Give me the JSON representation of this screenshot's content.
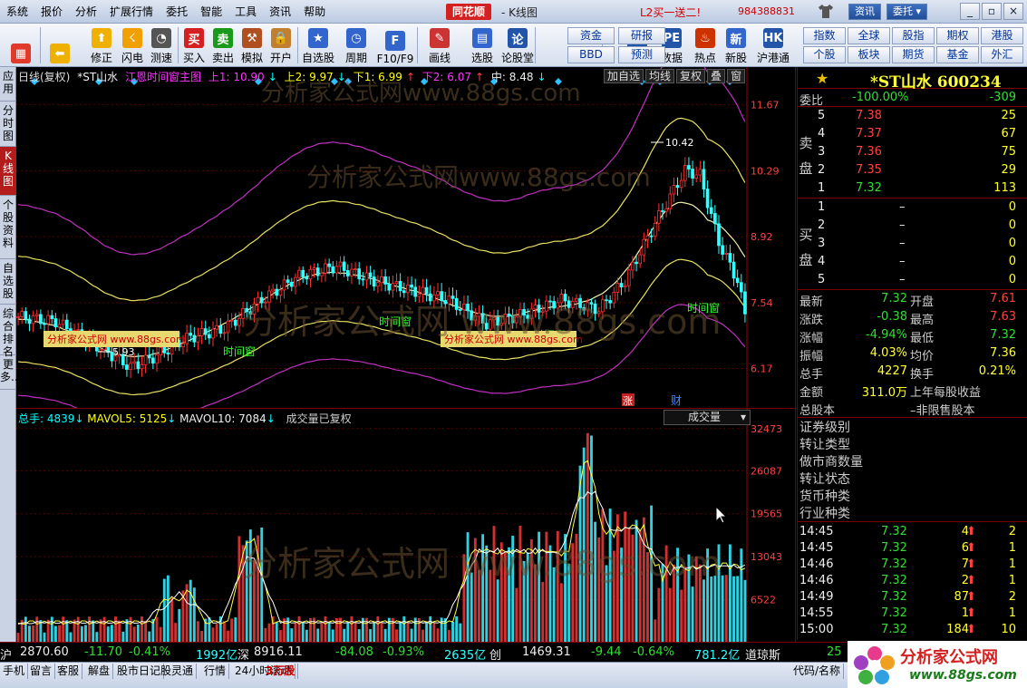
{
  "menubar": {
    "items": [
      "系统",
      "报价",
      "分析",
      "扩展行情",
      "委托",
      "智能",
      "工具",
      "资讯",
      "帮助"
    ],
    "brand": "同花顺",
    "window_title": "- K线图",
    "promo": "L2买一送二!",
    "account": "984388831",
    "btn_news": "资讯",
    "btn_trade": "委托 ▾",
    "min": "_",
    "restore": "▫",
    "close": "×"
  },
  "toolbar": {
    "buttons": [
      {
        "label": "",
        "icon": "app-grid-icon",
        "color": "#e03a2a"
      },
      {
        "label": "",
        "icon": "back-arrow-icon",
        "color": "#f0b000"
      },
      {
        "label": "修正",
        "icon": "up-arrow-icon",
        "color": "#f0b000"
      },
      {
        "label": "闪电",
        "icon": "lightning-icon",
        "color": "#f0a000"
      },
      {
        "label": "测速",
        "icon": "speed-icon",
        "color": "#555"
      },
      {
        "label": "买入",
        "icon": "buy-icon",
        "color": "#d42020"
      },
      {
        "label": "卖出",
        "icon": "sell-icon",
        "color": "#1a9a1a"
      },
      {
        "label": "模拟",
        "icon": "hammer-icon",
        "color": "#b05020"
      },
      {
        "label": "开户",
        "icon": "lock-icon",
        "color": "#c08030"
      },
      {
        "label": "自选股",
        "icon": "star-icon",
        "color": "#3366cc"
      },
      {
        "label": "周期",
        "icon": "clock-icon",
        "color": "#3366cc"
      },
      {
        "label": "F10/F9",
        "icon": "f10-icon",
        "color": "#3366cc"
      },
      {
        "label": "画线",
        "icon": "pen-icon",
        "color": "#cc3333"
      },
      {
        "label": "选股",
        "icon": "select-icon",
        "color": "#3366cc"
      },
      {
        "label": "论股堂",
        "icon": "discuss-icon",
        "color": "#2255aa"
      },
      {
        "label": "资讯",
        "icon": "news-icon",
        "color": "#2255aa"
      },
      {
        "label": "数据",
        "icon": "pe-icon",
        "color": "#2255aa"
      },
      {
        "label": "热点",
        "icon": "fire-icon",
        "color": "#cc3300"
      },
      {
        "label": "新股",
        "icon": "ipo-icon",
        "color": "#3366cc"
      },
      {
        "label": "沪港通",
        "icon": "hk-icon",
        "color": "#2255aa"
      }
    ],
    "quick": [
      [
        "资金",
        "研报"
      ],
      [
        "BBD",
        "预测"
      ],
      [
        "指数",
        "全球",
        "股指",
        "期权",
        "港股"
      ],
      [
        "个股",
        "板块",
        "期货",
        "基金",
        "外汇"
      ]
    ]
  },
  "left_tabs": [
    "应用",
    "分时图",
    "K线图",
    "个股资料",
    "自选股",
    "综合排名",
    "更多..."
  ],
  "kinfo": {
    "period": "日线(复权)",
    "name": "*ST山水",
    "indicator": "江恩时间窗主图",
    "up1": "上1: 10.90",
    "up2": "上2: 9.97",
    "down1": "下1: 6.99",
    "down2": "下2: 6.07",
    "mid": "中: 8.48"
  },
  "chart_buttons": [
    "加自选",
    "均线",
    "复权",
    "叠",
    "窗"
  ],
  "chart_data": [
    {
      "type": "candlestick",
      "title": "",
      "price_axis": {
        "ticks": [
          "11.67",
          "10.29",
          "8.92",
          "7.54",
          "6.17"
        ],
        "range": [
          5.5,
          12.3
        ]
      },
      "annotations": {
        "high": "10.42",
        "low": "5.93",
        "time_window": "时间窗",
        "watermark_tag": "分析家公式网 www.88gs.com"
      },
      "markers": {
        "rise": "涨",
        "finance": "财"
      }
    },
    {
      "type": "bar",
      "title": "",
      "ticks": [
        "32473",
        "26087",
        "19565",
        "13043",
        "6522"
      ],
      "range": [
        0,
        33000
      ],
      "info": {
        "volume": "总手: 4839",
        "ma5": "MAVOL5: 5125",
        "ma10": "MAVOL10: 7084",
        "note": "成交量已复权"
      },
      "selector": "成交量"
    }
  ],
  "stock": {
    "name": "*ST山水 600234",
    "weibi_label": "委比",
    "weibi_val": "-100.00%",
    "weicha_val": "-309",
    "sell_label": "卖盘",
    "buy_label": "买盘",
    "sell": [
      [
        "5",
        "7.38",
        "25"
      ],
      [
        "4",
        "7.37",
        "67"
      ],
      [
        "3",
        "7.36",
        "75"
      ],
      [
        "2",
        "7.35",
        "29"
      ],
      [
        "1",
        "7.32",
        "113"
      ]
    ],
    "buy": [
      [
        "1",
        "–",
        "0"
      ],
      [
        "2",
        "–",
        "0"
      ],
      [
        "3",
        "–",
        "0"
      ],
      [
        "4",
        "–",
        "0"
      ],
      [
        "5",
        "–",
        "0"
      ]
    ],
    "quote": [
      [
        "最新",
        "7.32",
        "开盘",
        "7.61"
      ],
      [
        "涨跌",
        "-0.38",
        "最高",
        "7.63"
      ],
      [
        "涨幅",
        "-4.94%",
        "最低",
        "7.32"
      ],
      [
        "振幅",
        "4.03%",
        "均价",
        "7.36"
      ],
      [
        "总手",
        "4227",
        "换手",
        "0.21%"
      ],
      [
        "金额",
        "311.0万",
        "上年每股收益",
        ""
      ],
      [
        "总股本",
        "",
        "–非限售股本",
        ""
      ]
    ],
    "attrs": [
      "证券级别",
      "转让类型",
      "做市商数量",
      "转让状态",
      "货币种类",
      "行业种类"
    ],
    "ticks": [
      [
        "14:45",
        "7.32",
        "4",
        "2"
      ],
      [
        "14:45",
        "7.32",
        "6",
        "1"
      ],
      [
        "14:46",
        "7.32",
        "7",
        "1"
      ],
      [
        "14:46",
        "7.32",
        "2",
        "1"
      ],
      [
        "14:49",
        "7.32",
        "87",
        "2"
      ],
      [
        "14:55",
        "7.32",
        "1",
        "1"
      ],
      [
        "15:00",
        "7.32",
        "184",
        "10"
      ]
    ]
  },
  "status": {
    "sh": "沪",
    "sh_val": "2870.60",
    "sh_chg": "-11.70",
    "sh_pct": "-0.41%",
    "sh_amt": "1992亿",
    "sz": "深",
    "sz_val": "8916.11",
    "sz_chg": "-84.08",
    "sz_pct": "-0.93%",
    "sz_amt": "2635亿",
    "cy": "创",
    "cy_val": "1469.31",
    "cy_chg": "-9.44",
    "cy_pct": "-0.64%",
    "cy_amt": "781.2亿",
    "dj": "道琼斯",
    "dj_val": "25"
  },
  "bottom": [
    "手机",
    "留言",
    "客服",
    "解盘",
    "股市日记",
    "股灵通",
    "行情",
    "24小时滚动",
    "3万股",
    "代码/名称"
  ],
  "site": {
    "name": "分析家公式网",
    "url": "www.88gs.com"
  },
  "watermark": "分析家公式网www.88gs.com",
  "watermark2": "分析家公式网  www.88gs.com"
}
